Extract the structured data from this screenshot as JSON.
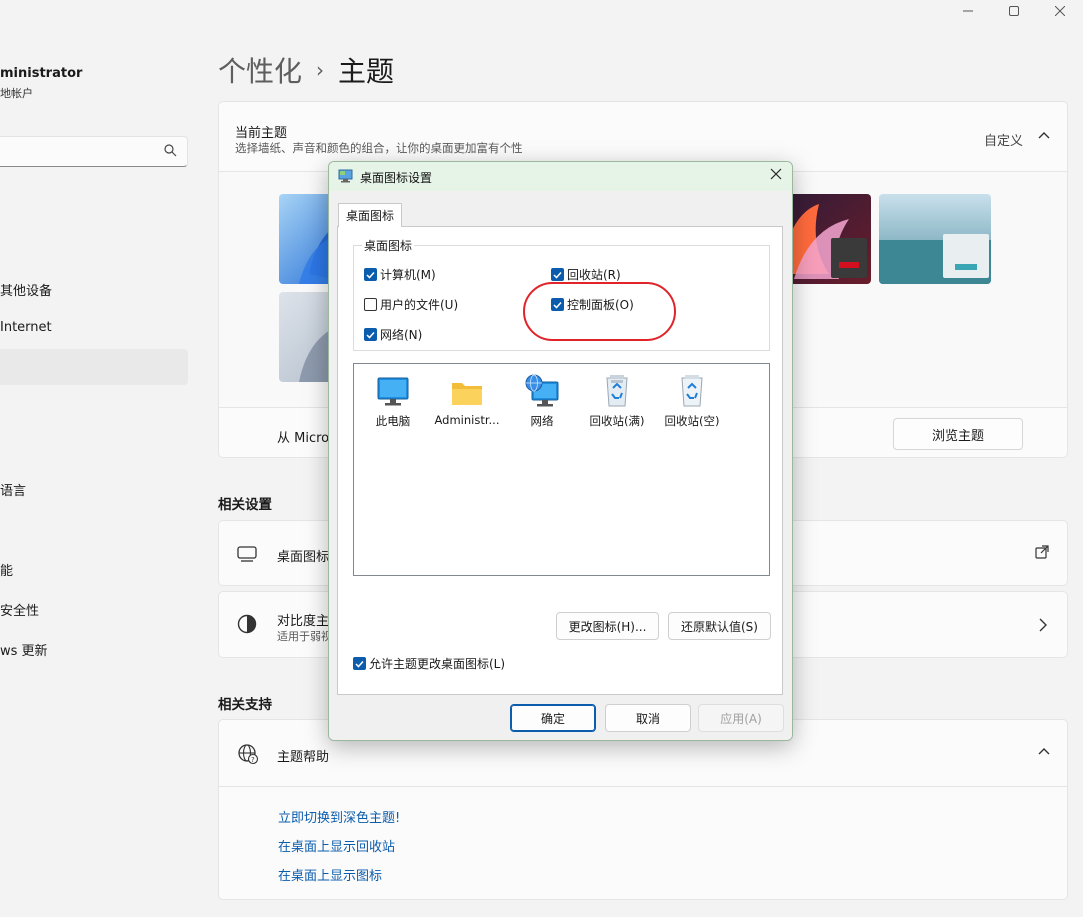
{
  "sidebar": {
    "user_name": "ministrator",
    "user_sub": "地帐户",
    "search_placeholder": "",
    "items": [
      {
        "label": "其他设备"
      },
      {
        "label": "Internet"
      },
      {
        "label": ""
      },
      {
        "label": "语言"
      },
      {
        "label": "能"
      },
      {
        "label": "安全性"
      },
      {
        "label": "ws 更新"
      }
    ]
  },
  "breadcrumb": {
    "parent": "个性化",
    "separator": "›",
    "current": "主题"
  },
  "current_theme": {
    "title": "当前主题",
    "subtitle": "选择墙纸、声音和颜色的组合，让你的桌面更加富有个性",
    "custom_label": "自定义",
    "store_text": "从 Micro",
    "browse_label": "浏览主题"
  },
  "related_settings": {
    "title": "相关设置",
    "desktop_icons_label": "桌面图标",
    "contrast_label": "对比度主",
    "contrast_sub": "适用于弱视"
  },
  "related_support": {
    "title": "相关支持",
    "help_label": "主题帮助",
    "links": [
      "立即切换到深色主题!",
      "在桌面上显示回收站",
      "在桌面上显示图标"
    ]
  },
  "dialog": {
    "title": "桌面图标设置",
    "tab": "桌面图标",
    "group_label": "桌面图标",
    "checkboxes": [
      {
        "label": "计算机(M)",
        "checked": true
      },
      {
        "label": "回收站(R)",
        "checked": true
      },
      {
        "label": "用户的文件(U)",
        "checked": false
      },
      {
        "label": "控制面板(O)",
        "checked": true
      },
      {
        "label": "网络(N)",
        "checked": true
      }
    ],
    "icons": [
      {
        "label": "此电脑",
        "icon": "monitor-icon"
      },
      {
        "label": "Administr...",
        "icon": "folder-icon"
      },
      {
        "label": "网络",
        "icon": "network-icon"
      },
      {
        "label": "回收站(满)",
        "icon": "recycle-bin-full-icon"
      },
      {
        "label": "回收站(空)",
        "icon": "recycle-bin-empty-icon"
      }
    ],
    "change_icon": "更改图标(H)...",
    "restore_default": "还原默认值(S)",
    "allow_themes": "允许主题更改桌面图标(L)",
    "allow_themes_checked": true,
    "ok": "确定",
    "cancel": "取消",
    "apply": "应用(A)"
  },
  "colors": {
    "accent": "#0b5cad",
    "annotation": "#e0242a",
    "dialog_title_bg": "#e6f4e8"
  }
}
